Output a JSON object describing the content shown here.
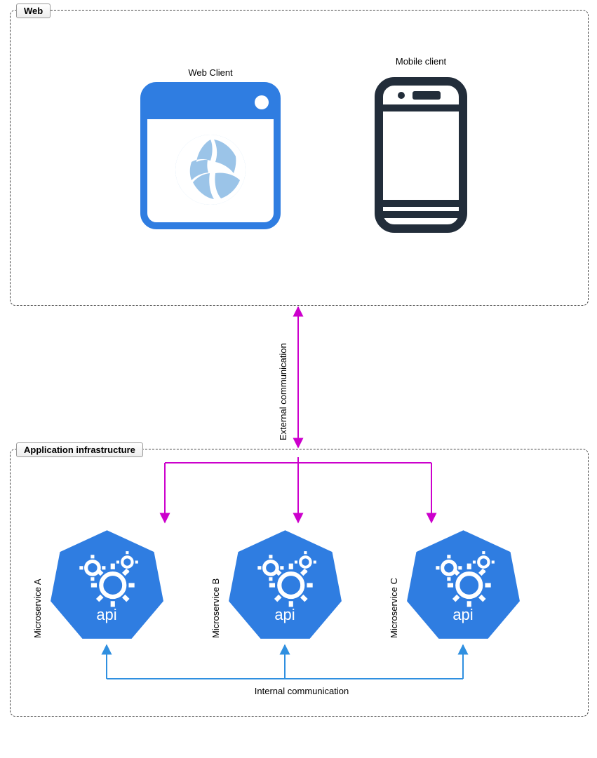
{
  "groups": {
    "web": "Web",
    "app": "Application infrastructure"
  },
  "nodes": {
    "webclient": "Web Client",
    "mobile": "Mobile client",
    "msA": "Microservice A",
    "msB": "Microservice B",
    "msC": "Microservice C",
    "api": "api"
  },
  "edges": {
    "external": "External communication",
    "internal": "Internal communication"
  },
  "colors": {
    "blue": "#2f7de1",
    "lightblue": "#9bc4e8",
    "dark": "#222d3a",
    "magenta": "#cc00cc",
    "arrowblue": "#2f8fe0"
  }
}
